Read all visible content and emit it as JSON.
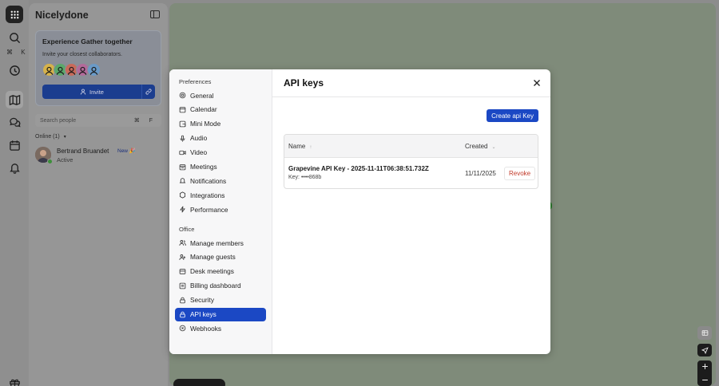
{
  "workspace": {
    "name": "Nicelydone"
  },
  "rail": {
    "shortcut": "⌘ K"
  },
  "invite_card": {
    "title": "Experience Gather together",
    "subtitle": "Invite your closest collaborators.",
    "invite_label": "Invite",
    "avatar_colors": [
      "#d6b24a",
      "#5aa86a",
      "#c86a5a",
      "#b36a9a",
      "#6a9ac8"
    ]
  },
  "people": {
    "search_placeholder": "Search people",
    "search_shortcut": "⌘ F",
    "online_label": "Online (1)",
    "users": [
      {
        "name": "Bertrand Bruandet",
        "status": "Active",
        "badge": "New 🎉"
      }
    ]
  },
  "settings_nav": {
    "preferences_label": "Preferences",
    "preferences": [
      {
        "label": "General",
        "icon": "gear-icon"
      },
      {
        "label": "Calendar",
        "icon": "calendar-icon"
      },
      {
        "label": "Mini Mode",
        "icon": "mini-mode-icon"
      },
      {
        "label": "Audio",
        "icon": "audio-icon"
      },
      {
        "label": "Video",
        "icon": "video-icon"
      },
      {
        "label": "Meetings",
        "icon": "meetings-icon"
      },
      {
        "label": "Notifications",
        "icon": "notifications-icon"
      },
      {
        "label": "Integrations",
        "icon": "integrations-icon"
      },
      {
        "label": "Performance",
        "icon": "performance-icon"
      }
    ],
    "office_label": "Office",
    "office": [
      {
        "label": "Manage members",
        "icon": "members-icon"
      },
      {
        "label": "Manage guests",
        "icon": "guests-icon"
      },
      {
        "label": "Desk meetings",
        "icon": "desk-icon"
      },
      {
        "label": "Billing dashboard",
        "icon": "billing-icon"
      },
      {
        "label": "Security",
        "icon": "lock-icon"
      },
      {
        "label": "API keys",
        "icon": "key-icon",
        "active": true
      },
      {
        "label": "Webhooks",
        "icon": "webhook-icon"
      }
    ]
  },
  "api_keys": {
    "title": "API keys",
    "create_label": "Create api Key",
    "columns": {
      "name": "Name",
      "created": "Created"
    },
    "rows": [
      {
        "name": "Grapevine API Key - 2025-11-11T06:38:51.732Z",
        "key": "Key: ••••868b",
        "created": "11/11/2025",
        "action": "Revoke"
      }
    ]
  },
  "colors": {
    "accent": "#1b48c4",
    "danger": "#c23a2a",
    "online": "#3c8f3a"
  }
}
